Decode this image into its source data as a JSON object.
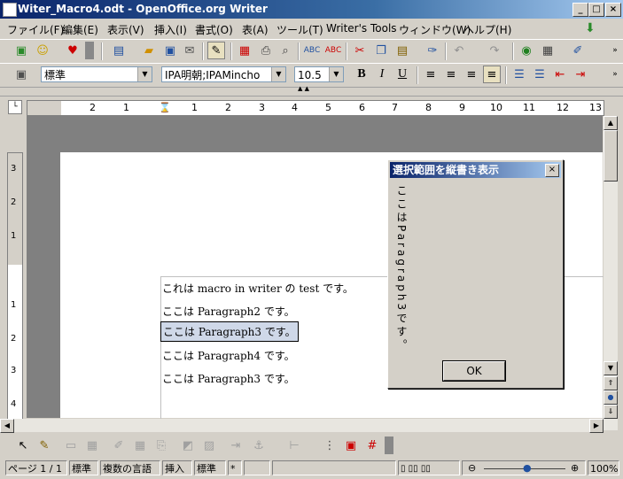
{
  "window": {
    "title": "Witer_Macro4.odt - OpenOffice.org  Writer",
    "min": "_",
    "max": "□",
    "close": "×"
  },
  "menu": [
    "ファイル(F)",
    "編集(E)",
    "表示(V)",
    "挿入(I)",
    "書式(O)",
    "表(A)",
    "ツール(T)",
    "Writer's Tools",
    "ウィンドウ(W)",
    "ヘルプ(H)"
  ],
  "format": {
    "style": "標準",
    "font": "IPA明朝;IPAMincho",
    "size": "10.5",
    "bold": "B",
    "italic": "I",
    "underline": "U"
  },
  "ruler": [
    "2",
    "1",
    "1",
    "2",
    "3",
    "4",
    "5",
    "6",
    "7",
    "8",
    "9",
    "10",
    "11",
    "12",
    "13"
  ],
  "vruler": [
    "3",
    "2",
    "1",
    "1",
    "2",
    "3",
    "4"
  ],
  "document": {
    "lines": [
      "これは macro in writer の test です。",
      "ここは Paragraph2 です。",
      "ここは Paragraph3 です。",
      "ここは Paragraph4 です。",
      "ここは Paragraph3 です。"
    ],
    "selected_index": 2
  },
  "dialog": {
    "title": "選択範囲を縦書き表示",
    "text": "ここはParagraph3です。",
    "ok": "OK"
  },
  "status": {
    "page": "ページ 1 / 1",
    "style": "標準",
    "lang": "複数の言語",
    "mode": "挿入",
    "sel": "標準",
    "mod": "*",
    "zoom": "100%"
  },
  "colors": {
    "title_start": "#0a246a",
    "title_end": "#a6caf0",
    "selection": "#cfd8e8"
  }
}
